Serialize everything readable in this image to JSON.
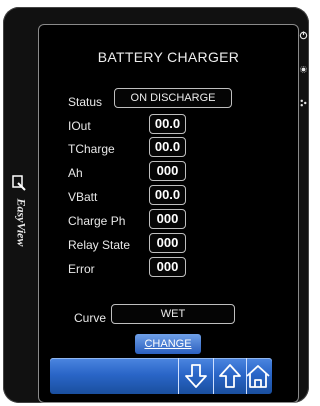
{
  "device": {
    "brand": "EasyView",
    "side_buttons": [
      "power-icon",
      "sun-icon",
      "share-icon"
    ]
  },
  "screen": {
    "title": "BATTERY CHARGER",
    "status": {
      "label": "Status",
      "value": "ON DISCHARGE"
    },
    "fields": [
      {
        "label": "IOut",
        "value": "00.0"
      },
      {
        "label": "TCharge",
        "value": "00.0"
      },
      {
        "label": "Ah",
        "value": "000"
      },
      {
        "label": "VBatt",
        "value": "00.0"
      },
      {
        "label": "Charge Ph",
        "value": "000"
      },
      {
        "label": "Relay State",
        "value": "000"
      },
      {
        "label": "Error",
        "value": "000"
      }
    ],
    "curve": {
      "label": "Curve",
      "value": "WET"
    },
    "change_label": "CHANGE"
  },
  "navbar": {
    "icons": [
      "arrow-down-icon",
      "arrow-up-icon",
      "home-icon"
    ],
    "color": "#2a66c8"
  }
}
